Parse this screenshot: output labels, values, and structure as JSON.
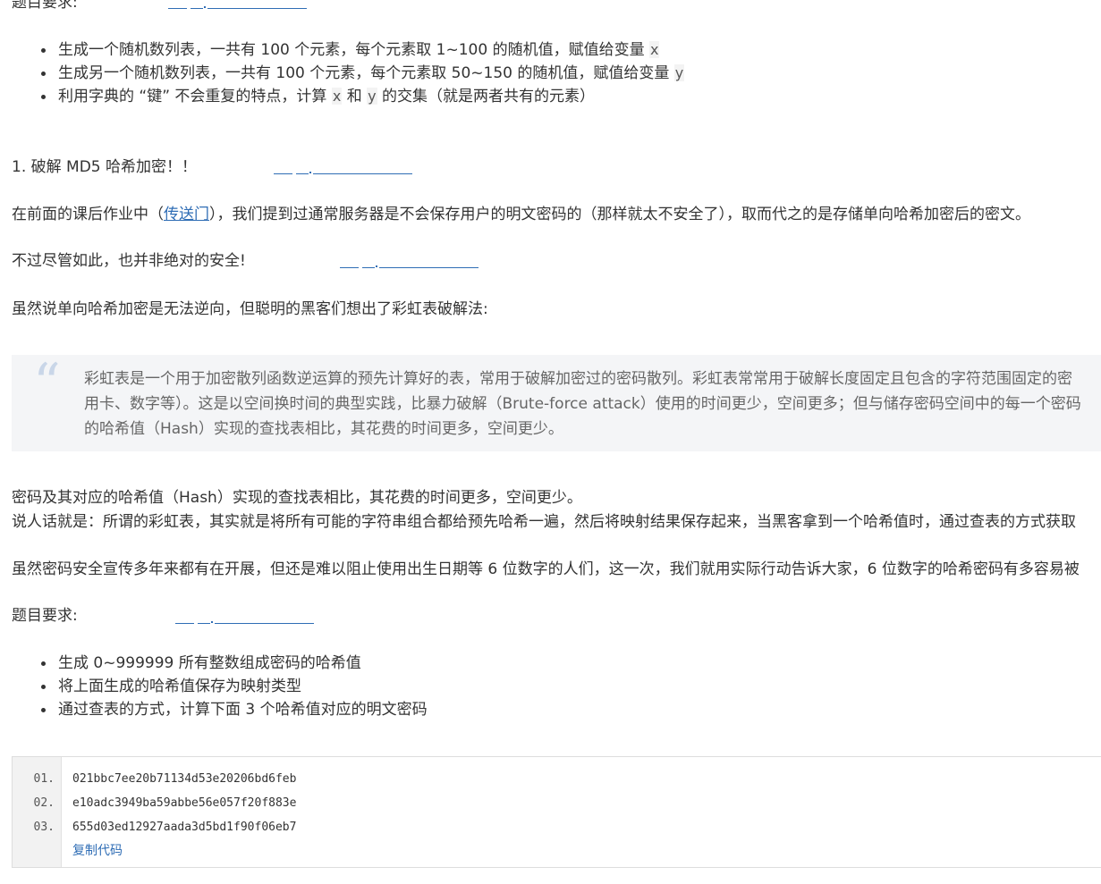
{
  "section1": {
    "heading": "题目要求:",
    "bullets": [
      {
        "before": "生成一个随机数列表，一共有 100 个元素，每个元素取 1~100 的随机值，赋值给变量",
        "code": "x",
        "after": ""
      },
      {
        "before": "生成另一个随机数列表，一共有 100 个元素，每个元素取 50~150 的随机值，赋值给变量",
        "code": "y",
        "after": ""
      },
      {
        "before": "利用字典的 “键” 不会重复的特点，计算",
        "code": "x",
        "mid": "和",
        "code2": "y",
        "after": "的交集（就是两者共有的元素）"
      }
    ]
  },
  "section2": {
    "title": "1. 破解 MD5 哈希加密！！",
    "para1_before": "在前面的课后作业中（",
    "para1_link": "传送门",
    "para1_after": "），我们提到过通常服务器是不会保存用户的明文密码的（那样就太不安全了），取而代之的是存储单向哈希加密后的密文。",
    "para2": "不过尽管如此，也并非绝对的安全!",
    "para3": "虽然说单向哈希加密是无法逆向，但聪明的黑客们想出了彩虹表破解法:",
    "quote_lines": [
      "彩虹表是一个用于加密散列函数逆运算的预先计算好的表，常用于破解加密过的密码散列。彩虹表常常用于破解长度固定且包含的字符范围固定的密",
      "用卡、数字等）。这是以空间换时间的典型实践，比暴力破解（Brute-force attack）使用的时间更少，空间更多；但与储存密码空间中的每一个密码",
      "的哈希值（Hash）实现的查找表相比，其花费的时间更多，空间更少。"
    ],
    "para4_line1": "密码及其对应的哈希值（Hash）实现的查找表相比，其花费的时间更多，空间更少。",
    "para4_line2": "说人话就是：所谓的彩虹表，其实就是将所有可能的字符串组合都给预先哈希一遍，然后将映射结果保存起来，当黑客拿到一个哈希值时，通过查表的方式获取",
    "para5": "虽然密码安全宣传多年来都有在开展，但还是难以阻止使用出生日期等 6 位数字的人们，这一次，我们就用实际行动告诉大家，6 位数字的哈希密码有多容易被",
    "heading2": "题目要求:",
    "bullets2": [
      "生成 0~999999 所有整数组成密码的哈希值",
      "将上面生成的哈希值保存为映射类型",
      "通过查表的方式，计算下面 3 个哈希值对应的明文密码"
    ]
  },
  "code_block": {
    "line_numbers": [
      "01.",
      "02.",
      "03."
    ],
    "lines": [
      "021bbc7ee20b71134d53e20206bd6feb",
      "e10adc3949ba59abbe56e057f20f883e",
      "655d03ed12927aada3d5bd1f90f06eb7"
    ],
    "copy_label": "复制代码"
  }
}
